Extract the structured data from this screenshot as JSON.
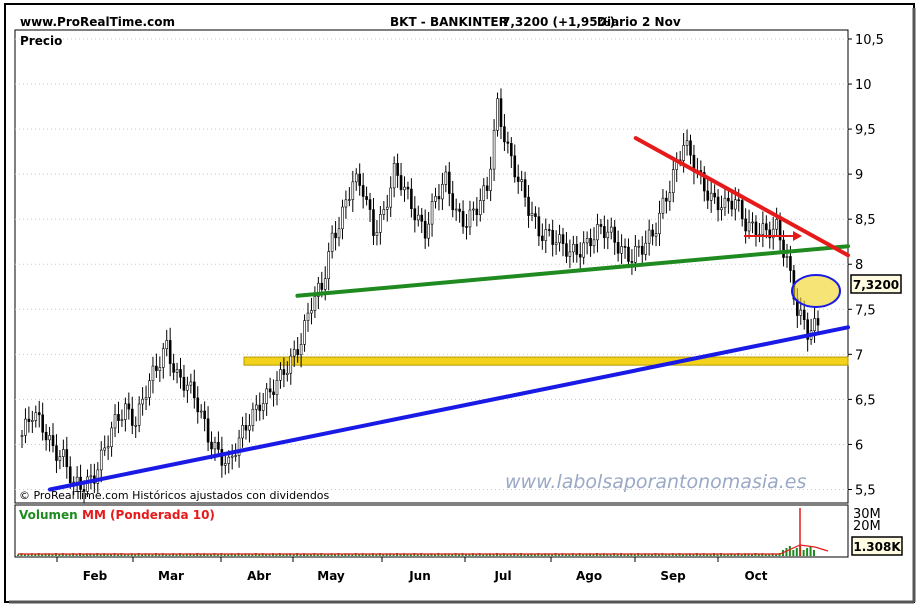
{
  "header": {
    "site": "www.ProRealTime.com",
    "instrument": "BKT - BANKINTER",
    "quote": "7,3200 (+1,95%)",
    "period": "Diario",
    "date": "2 Nov"
  },
  "chart_data": {
    "type": "candlestick",
    "panel_label": "Precio",
    "ylim": [
      5.35,
      10.6
    ],
    "y_ticks": [
      "10,5",
      "10",
      "9,5",
      "9",
      "8,5",
      "8",
      "7,5",
      "7",
      "6,5",
      "6",
      "5,5"
    ],
    "last_price_label": "7,3200",
    "months": [
      "Feb",
      "Mar",
      "Abr",
      "May",
      "Jun",
      "Jul",
      "Ago",
      "Sep",
      "Oct"
    ],
    "series": [
      {
        "name": "price",
        "values": [
          6.1,
          6.3,
          6.2,
          6.0,
          5.85,
          5.5,
          5.55,
          5.7,
          5.95,
          6.2,
          6.4,
          6.3,
          6.6,
          6.8,
          7.1,
          6.8,
          6.65,
          6.4,
          6.1,
          5.95,
          5.75,
          6.0,
          6.3,
          6.5,
          6.55,
          6.7,
          6.95,
          7.2,
          7.55,
          7.7,
          8.3,
          8.6,
          8.9,
          8.8,
          8.4,
          8.6,
          9.0,
          8.8,
          8.6,
          8.4,
          8.7,
          8.9,
          8.6,
          8.5,
          8.6,
          8.8,
          9.8,
          9.3,
          8.9,
          8.6,
          8.4,
          8.35,
          8.2,
          8.1,
          8.2,
          8.3,
          8.35,
          8.3,
          8.2,
          8.1,
          8.15,
          8.3,
          8.7,
          9.0,
          9.3,
          9.1,
          8.9,
          8.7,
          8.6,
          8.7,
          8.5,
          8.4,
          8.3,
          8.4,
          8.1,
          7.5,
          7.2,
          7.32
        ]
      }
    ],
    "trendlines": [
      {
        "name": "support-blue",
        "color": "#1a1ae6",
        "points": [
          [
            0,
            5.5
          ],
          [
            100,
            7.3
          ]
        ]
      },
      {
        "name": "support-green",
        "color": "#1f8a1f",
        "points": [
          [
            31,
            7.65
          ],
          [
            100,
            8.2
          ]
        ]
      },
      {
        "name": "resistance-red",
        "color": "#e61a1a",
        "points": [
          [
            74,
            9.4
          ],
          [
            100,
            8.1
          ]
        ]
      }
    ],
    "support_zone": {
      "color": "#f2d21a",
      "range": [
        6.88,
        6.97
      ]
    },
    "volume_panel": {
      "label_volumen": "Volumen",
      "label_mm": "MM (Ponderada 10)",
      "y_ticks": [
        "30M",
        "20M"
      ],
      "last_value_label": "1.308K",
      "volume_color": "#1f8a1f",
      "mm_color": "#e61a1a"
    },
    "copyright": "© ProRealTime.com  Históricos ajustados con dividendos",
    "watermark": "www.labolsaporantonomasia.es"
  }
}
